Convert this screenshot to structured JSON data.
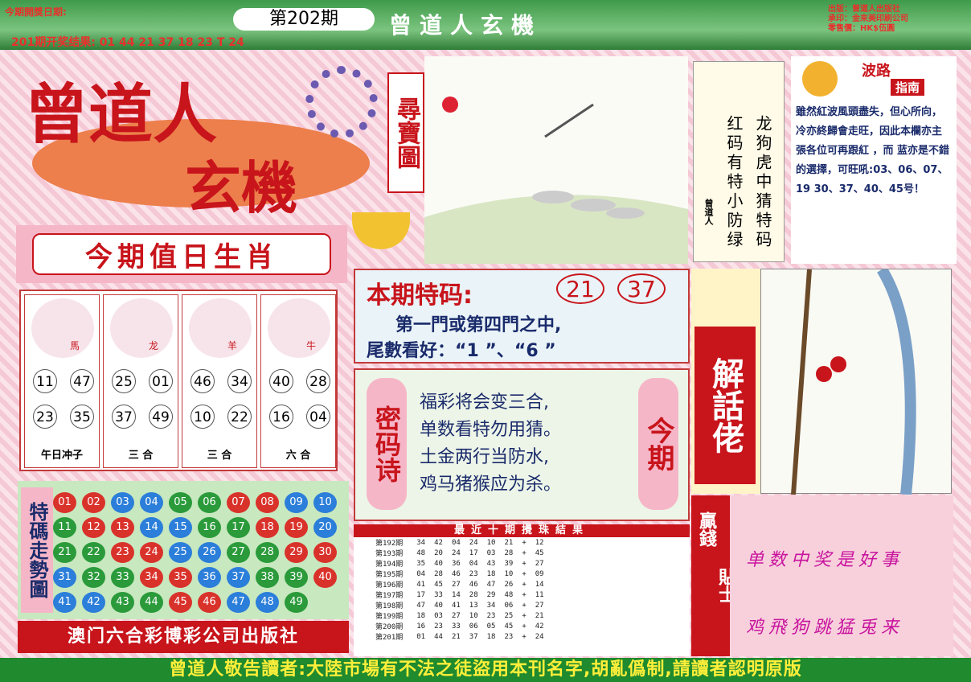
{
  "header": {
    "open_date_label": "今期開獎日期:",
    "issue": "第202期",
    "last_result": "201期开奖结果: 01 44 21 37 18 23 T 24",
    "title": "曾道人玄機",
    "publisher": "出版：曾道人出版社",
    "printer": "承印：金來美印刷公司",
    "price": "零售價：HK$伍圓"
  },
  "logo": {
    "line1": "曾道人",
    "line2": "玄機",
    "treasure": "尋寶圖"
  },
  "zodiac": {
    "heading": "今期值日生肖",
    "animals": [
      {
        "label": "馬",
        "nums": [
          "11",
          "47",
          "23",
          "35"
        ],
        "tag": "午日冲子"
      },
      {
        "label": "龙",
        "nums": [
          "25",
          "01",
          "37",
          "49"
        ],
        "tag": "三 合"
      },
      {
        "label": "羊",
        "nums": [
          "46",
          "34",
          "10",
          "22"
        ],
        "tag": "三 合"
      },
      {
        "label": "牛",
        "nums": [
          "40",
          "28",
          "16",
          "04"
        ],
        "tag": "六 合"
      }
    ]
  },
  "poem_strip": {
    "author": "曾道人",
    "right": "龙狗虎中猜特码",
    "left": "红码有特小防绿"
  },
  "wave": {
    "title1": "波路",
    "title2": "指南",
    "text": "雖然紅波風頭盡失，但心所向，冷亦終歸會走旺，因此本欄亦主張各位可再跟紅 ，而 蓝亦是不錯的選擇，可旺吼:03、06、07、19 30、37、40、45号！"
  },
  "special": {
    "label": "本期特码:",
    "n1": "21",
    "n2": "37",
    "line1": "第一門或第四門之中,",
    "line2": "尾數看好：“1 ”、“6 ”"
  },
  "mima": {
    "side": "密码诗",
    "right": "今期",
    "lines": [
      "福彩将会变三合,",
      "单数看特勿用猜。",
      "土金两行当防水,",
      "鸡马猪猴应为杀。"
    ]
  },
  "jiehua": {
    "title": "解話佬"
  },
  "trend": {
    "side": "特碼走勢圖",
    "balls": [
      [
        "01",
        "red"
      ],
      [
        "02",
        "red"
      ],
      [
        "03",
        "blue"
      ],
      [
        "04",
        "blue"
      ],
      [
        "05",
        "green"
      ],
      [
        "06",
        "green"
      ],
      [
        "07",
        "red"
      ],
      [
        "08",
        "red"
      ],
      [
        "09",
        "blue"
      ],
      [
        "10",
        "blue"
      ],
      [
        "11",
        "green"
      ],
      [
        "12",
        "red"
      ],
      [
        "13",
        "red"
      ],
      [
        "14",
        "blue"
      ],
      [
        "15",
        "blue"
      ],
      [
        "16",
        "green"
      ],
      [
        "17",
        "green"
      ],
      [
        "18",
        "red"
      ],
      [
        "19",
        "red"
      ],
      [
        "20",
        "blue"
      ],
      [
        "21",
        "green"
      ],
      [
        "22",
        "green"
      ],
      [
        "23",
        "red"
      ],
      [
        "24",
        "red"
      ],
      [
        "25",
        "blue"
      ],
      [
        "26",
        "blue"
      ],
      [
        "27",
        "green"
      ],
      [
        "28",
        "green"
      ],
      [
        "29",
        "red"
      ],
      [
        "30",
        "red"
      ],
      [
        "31",
        "blue"
      ],
      [
        "32",
        "green"
      ],
      [
        "33",
        "green"
      ],
      [
        "34",
        "red"
      ],
      [
        "35",
        "red"
      ],
      [
        "36",
        "blue"
      ],
      [
        "37",
        "blue"
      ],
      [
        "38",
        "green"
      ],
      [
        "39",
        "green"
      ],
      [
        "40",
        "red"
      ],
      [
        "41",
        "blue"
      ],
      [
        "42",
        "blue"
      ],
      [
        "43",
        "green"
      ],
      [
        "44",
        "green"
      ],
      [
        "45",
        "red"
      ],
      [
        "46",
        "red"
      ],
      [
        "47",
        "blue"
      ],
      [
        "48",
        "blue"
      ],
      [
        "49",
        "green"
      ]
    ],
    "publisher": "澳门六合彩博彩公司出版社"
  },
  "history": {
    "title": "最近十期攪珠結果",
    "rows": [
      [
        "第192期",
        "34",
        "42",
        "04",
        "24",
        "10",
        "21",
        "+",
        "12"
      ],
      [
        "第193期",
        "48",
        "20",
        "24",
        "17",
        "03",
        "28",
        "+",
        "45"
      ],
      [
        "第194期",
        "35",
        "40",
        "36",
        "04",
        "43",
        "39",
        "+",
        "27"
      ],
      [
        "第195期",
        "04",
        "28",
        "46",
        "23",
        "18",
        "10",
        "+",
        "09"
      ],
      [
        "第196期",
        "41",
        "45",
        "27",
        "46",
        "47",
        "26",
        "+",
        "14"
      ],
      [
        "第197期",
        "17",
        "33",
        "14",
        "28",
        "29",
        "48",
        "+",
        "11"
      ],
      [
        "第198期",
        "47",
        "40",
        "41",
        "13",
        "34",
        "06",
        "+",
        "27"
      ],
      [
        "第199期",
        "18",
        "03",
        "27",
        "10",
        "23",
        "25",
        "+",
        "21"
      ],
      [
        "第200期",
        "16",
        "23",
        "33",
        "06",
        "05",
        "45",
        "+",
        "42"
      ],
      [
        "第201期",
        "01",
        "44",
        "21",
        "37",
        "18",
        "23",
        "+",
        "24"
      ]
    ]
  },
  "tips": {
    "side1": "贏錢",
    "side2": "貼士",
    "line1": "单数中奖是好事",
    "line2": "鸡飛狗跳猛兎来"
  },
  "footer": "曾道人敬告讀者:大陸市場有不法之徒盜用本刊名字,胡亂僞制,請讀者認明原版"
}
